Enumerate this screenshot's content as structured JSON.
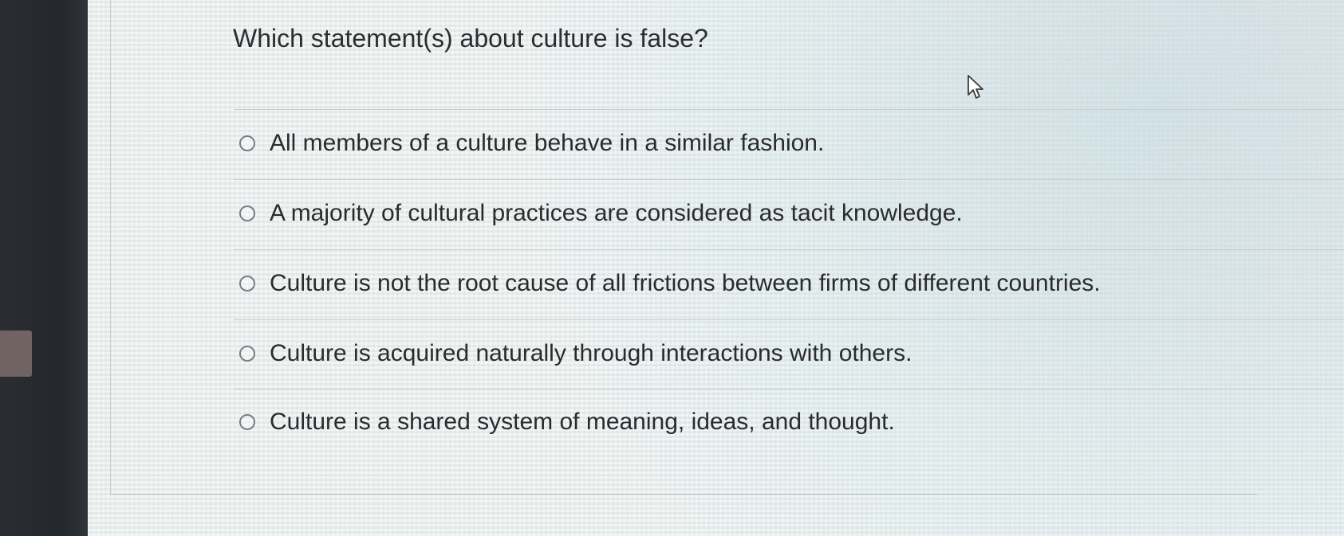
{
  "question": {
    "text": "Which statement(s) about culture is false?"
  },
  "options": [
    {
      "label": "All members of a culture behave in a similar fashion.",
      "selected": false
    },
    {
      "label": "A majority of cultural practices are considered as tacit knowledge.",
      "selected": false
    },
    {
      "label": "Culture is not the root cause of all frictions between firms of different countries.",
      "selected": false
    },
    {
      "label": "Culture is acquired naturally through interactions with others.",
      "selected": false
    },
    {
      "label": "Culture is a shared system of meaning, ideas, and thought.",
      "selected": false
    }
  ],
  "cursor": {
    "icon": "mouse-pointer-icon"
  }
}
